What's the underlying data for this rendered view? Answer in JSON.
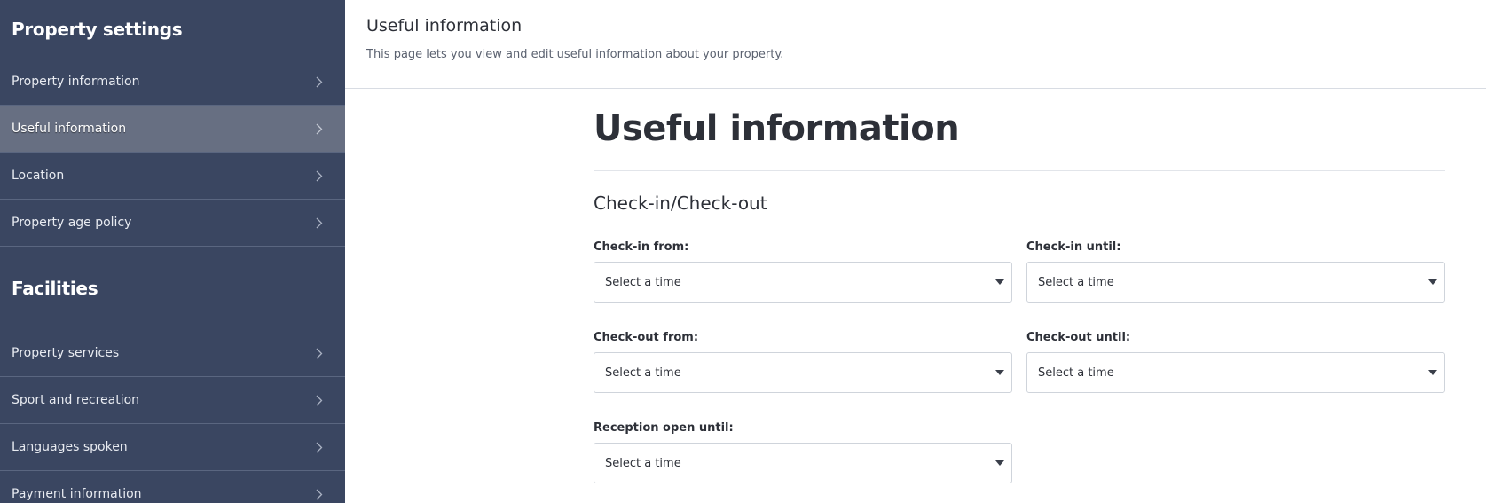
{
  "sidebar": {
    "property_settings_title": "Property settings",
    "property_settings_items": [
      {
        "label": "Property information",
        "active": false
      },
      {
        "label": "Useful information",
        "active": true
      },
      {
        "label": "Location",
        "active": false
      },
      {
        "label": "Property age policy",
        "active": false
      }
    ],
    "facilities_title": "Facilities",
    "facilities_items": [
      {
        "label": "Property services",
        "active": false
      },
      {
        "label": "Sport and recreation",
        "active": false
      },
      {
        "label": "Languages spoken",
        "active": false
      },
      {
        "label": "Payment information",
        "active": false
      }
    ]
  },
  "header": {
    "title": "Useful information",
    "description": "This page lets you view and edit useful information about your property."
  },
  "content": {
    "title": "Useful information",
    "section_title": "Check-in/Check-out",
    "fields": {
      "checkin_from": {
        "label": "Check-in from:",
        "value": "Select a time"
      },
      "checkin_until": {
        "label": "Check-in until:",
        "value": "Select a time"
      },
      "checkout_from": {
        "label": "Check-out from:",
        "value": "Select a time"
      },
      "checkout_until": {
        "label": "Check-out until:",
        "value": "Select a time"
      },
      "reception_open_until": {
        "label": "Reception open until:",
        "value": "Select a time"
      }
    }
  },
  "icons": {
    "chevron": "chevron-right-icon",
    "caret": "caret-down-icon"
  },
  "colors": {
    "sidebar_bg": "#3a4661",
    "sidebar_active_bg": "#676f82",
    "sidebar_divider": "#5a6680",
    "text_primary": "#2d3038"
  }
}
